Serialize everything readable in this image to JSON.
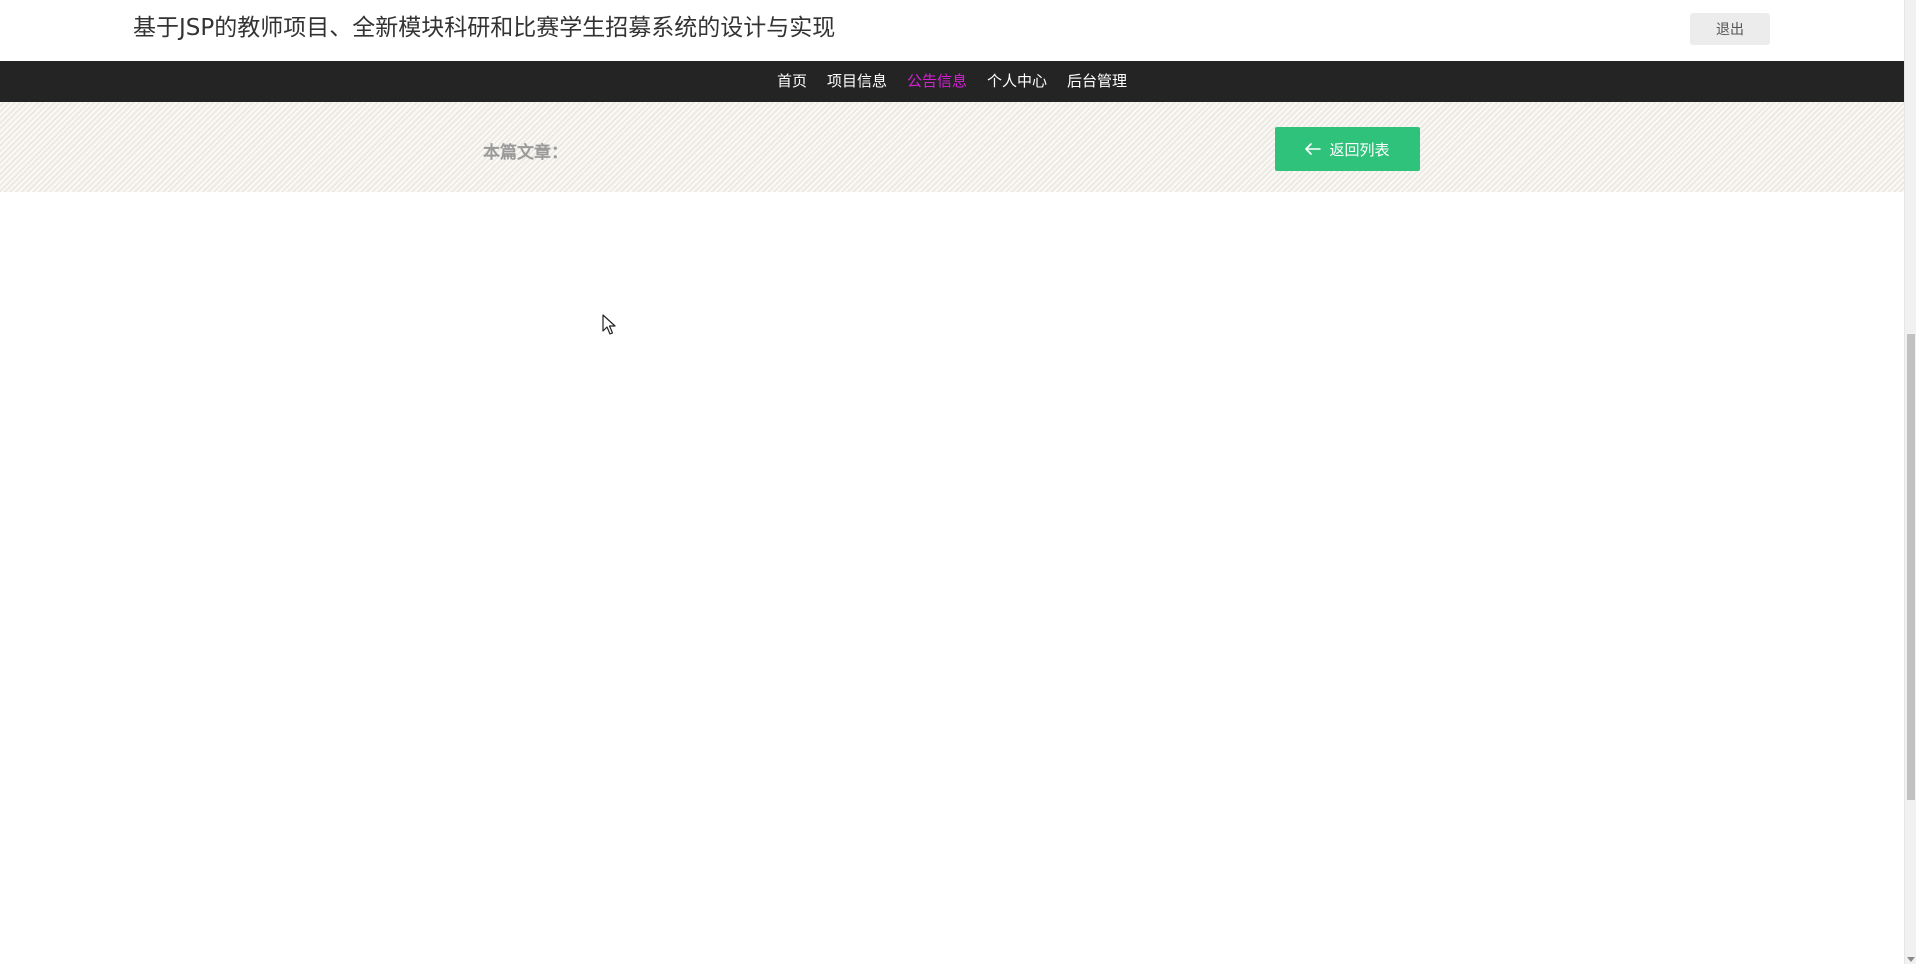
{
  "header": {
    "site_title": "基于JSP的教师项目、全新模块科研和比赛学生招募系统的设计与实现",
    "logout_label": "退出"
  },
  "nav": {
    "items": [
      {
        "label": "首页",
        "active": false
      },
      {
        "label": "项目信息",
        "active": false
      },
      {
        "label": "公告信息",
        "active": true
      },
      {
        "label": "个人中心",
        "active": false
      },
      {
        "label": "后台管理",
        "active": false
      }
    ],
    "active_color": "#d61fd6"
  },
  "article": {
    "label": "本篇文章：",
    "back_button_label": "返回列表",
    "back_button_icon": "arrow-left-icon",
    "back_button_color": "#2fc27a"
  },
  "colors": {
    "navbar_bg": "#242424",
    "band_bg": "#f3f1ec"
  }
}
